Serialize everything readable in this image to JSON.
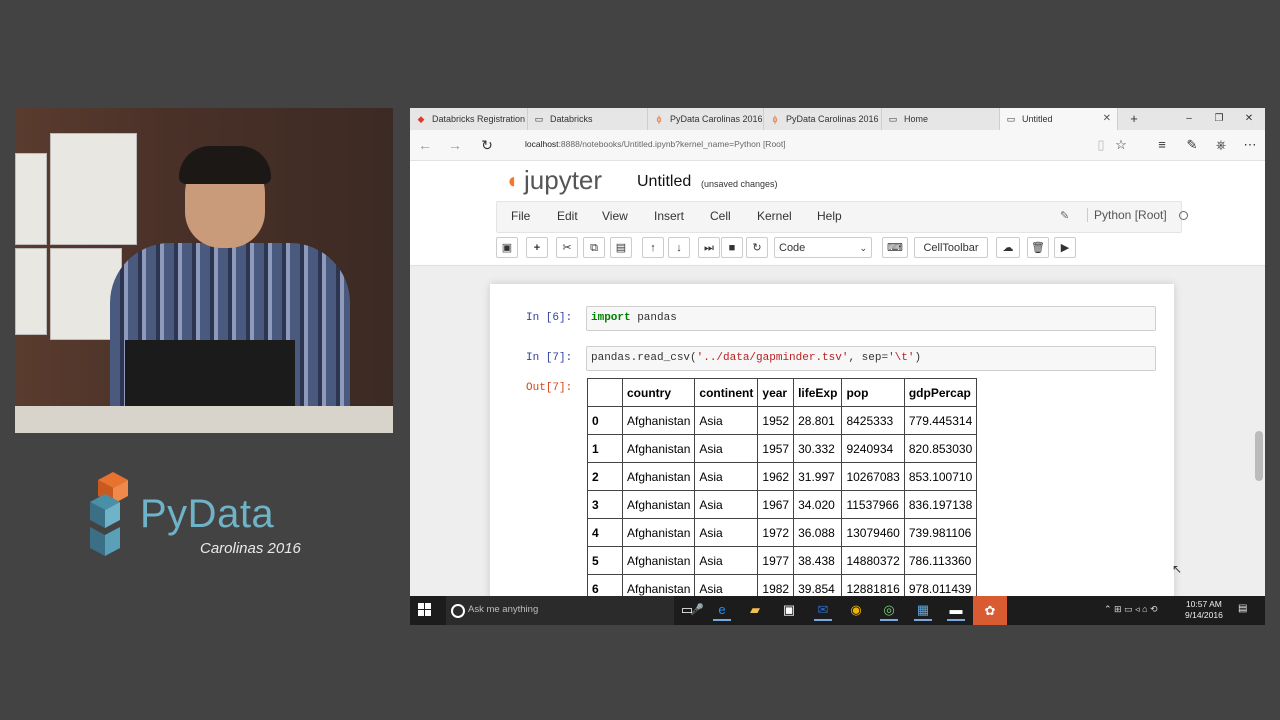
{
  "logo": {
    "brand": "PyData",
    "event": "Carolinas 2016"
  },
  "browser": {
    "tabs": [
      {
        "icon": "databricks-icon",
        "label": "Databricks Registration"
      },
      {
        "icon": "page-icon",
        "label": "Databricks"
      },
      {
        "icon": "pydata-icon",
        "label": "PyData Carolinas 2016"
      },
      {
        "icon": "pydata-icon",
        "label": "PyData Carolinas 2016"
      },
      {
        "icon": "page-icon",
        "label": "Home"
      },
      {
        "icon": "page-icon",
        "label": "Untitled",
        "active": true
      }
    ],
    "url_host": "localhost",
    "url_rest": ":8888/notebooks/Untitled.ipynb?kernel_name=Python [Root]"
  },
  "jupyter": {
    "logo_text": "jupyter",
    "notebook_name": "Untitled",
    "save_status": "(unsaved changes)",
    "menus": [
      "File",
      "Edit",
      "View",
      "Insert",
      "Cell",
      "Kernel",
      "Help"
    ],
    "kernel_name": "Python [Root]",
    "cell_type": "Code",
    "celltoolbar_label": "CellToolbar"
  },
  "cells": [
    {
      "prompt": "In [6]:",
      "code_kw": "import",
      "code_rest": " pandas"
    },
    {
      "prompt": "In [7]:",
      "code_pre": "pandas.read_csv(",
      "code_str1": "'../data/gapminder.tsv'",
      "code_mid": ", sep=",
      "code_str2": "'\\t'",
      "code_post": ")",
      "out_prompt": "Out[7]:"
    }
  ],
  "table": {
    "columns": [
      "",
      "country",
      "continent",
      "year",
      "lifeExp",
      "pop",
      "gdpPercap"
    ],
    "rows": [
      [
        "0",
        "Afghanistan",
        "Asia",
        "1952",
        "28.801",
        "8425333",
        "779.445314"
      ],
      [
        "1",
        "Afghanistan",
        "Asia",
        "1957",
        "30.332",
        "9240934",
        "820.853030"
      ],
      [
        "2",
        "Afghanistan",
        "Asia",
        "1962",
        "31.997",
        "10267083",
        "853.100710"
      ],
      [
        "3",
        "Afghanistan",
        "Asia",
        "1967",
        "34.020",
        "11537966",
        "836.197138"
      ],
      [
        "4",
        "Afghanistan",
        "Asia",
        "1972",
        "36.088",
        "13079460",
        "739.981106"
      ],
      [
        "5",
        "Afghanistan",
        "Asia",
        "1977",
        "38.438",
        "14880372",
        "786.113360"
      ],
      [
        "6",
        "Afghanistan",
        "Asia",
        "1982",
        "39.854",
        "12881816",
        "978.011439"
      ]
    ]
  },
  "taskbar": {
    "search_placeholder": "Ask me anything",
    "time": "10:57 AM",
    "date": "9/14/2016"
  },
  "colors": {
    "jupyter_orange": "#f37726",
    "pydata_blue": "#6fb3c8",
    "in_prompt": "#303f9f",
    "out_prompt": "#d84315"
  }
}
